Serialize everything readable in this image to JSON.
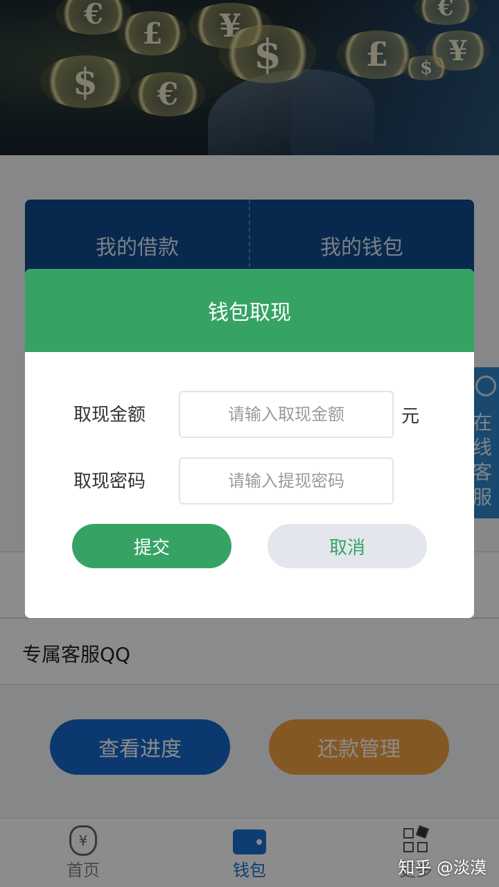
{
  "banner": {
    "coins": [
      "€",
      "£",
      "¥",
      "$",
      "$",
      "€",
      "£",
      "¥",
      "€",
      "$",
      "€",
      "¥"
    ]
  },
  "card": {
    "left_label": "我的借款",
    "right_label": "我的钱包"
  },
  "customer_service": {
    "label": "在线客服"
  },
  "list": {
    "row1_label": "",
    "row1_arrow": "",
    "row2_label": "专属客服QQ"
  },
  "actions": {
    "progress_label": "查看进度",
    "repay_label": "还款管理"
  },
  "tabbar": {
    "tabs": [
      {
        "label": "首页",
        "icon": "money-bag-icon"
      },
      {
        "label": "钱包",
        "icon": "wallet-icon"
      },
      {
        "label": "更多",
        "icon": "grid-icon"
      }
    ],
    "active_index": 1
  },
  "modal": {
    "title": "钱包取现",
    "amount_label": "取现金额",
    "amount_placeholder": "请输入取现金额",
    "amount_value": "",
    "unit": "元",
    "password_label": "取现密码",
    "password_placeholder": "请输入提现密码",
    "password_value": "",
    "submit_label": "提交",
    "cancel_label": "取消"
  },
  "watermark": "知乎 @淡漠",
  "colors": {
    "modal_header": "#36a365",
    "card_blue": "#0f4a8f",
    "progress_button": "#1566c8",
    "repay_button": "#f0a040",
    "active_tab": "#1a6fd0"
  }
}
